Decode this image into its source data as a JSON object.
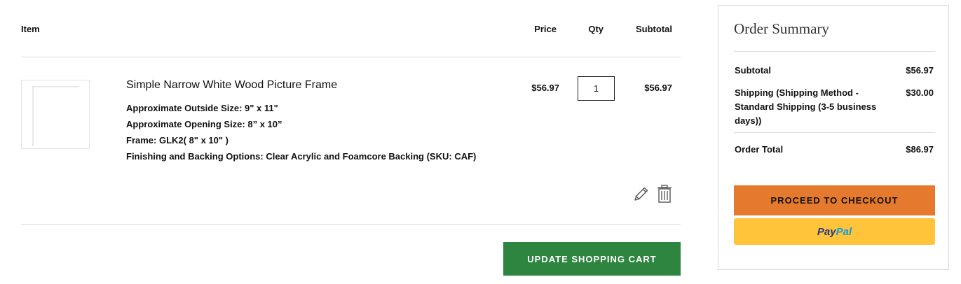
{
  "table": {
    "headers": {
      "item": "Item",
      "price": "Price",
      "qty": "Qty",
      "subtotal": "Subtotal"
    },
    "items": [
      {
        "name": "Simple Narrow White Wood Picture Frame",
        "options": [
          "Approximate Outside Size: 9\" x 11\"",
          "Approximate Opening Size: 8” x 10”",
          "Frame: GLK2( 8\" x 10\" )",
          "Finishing and Backing Options: Clear Acrylic and Foamcore Backing (SKU: CAF)"
        ],
        "price": "$56.97",
        "qty": "1",
        "subtotal": "$56.97",
        "icons": {
          "edit": "pencil-icon",
          "delete": "trash-icon"
        }
      }
    ],
    "update_button": "UPDATE SHOPPING CART"
  },
  "summary": {
    "title": "Order Summary",
    "subtotal_label": "Subtotal",
    "subtotal_value": "$56.97",
    "shipping_label": "Shipping (Shipping Method - Standard Shipping (3-5 business days))",
    "shipping_value": "$30.00",
    "total_label": "Order Total",
    "total_value": "$86.97",
    "checkout_button": "PROCEED TO CHECKOUT",
    "paypal": {
      "part1": "Pay",
      "part2": "Pal"
    }
  },
  "colors": {
    "update_button": "#2e8540",
    "checkout_button": "#e57a2e",
    "paypal_button": "#ffc439",
    "paypal_dark": "#253b80",
    "paypal_light": "#179bd7"
  }
}
